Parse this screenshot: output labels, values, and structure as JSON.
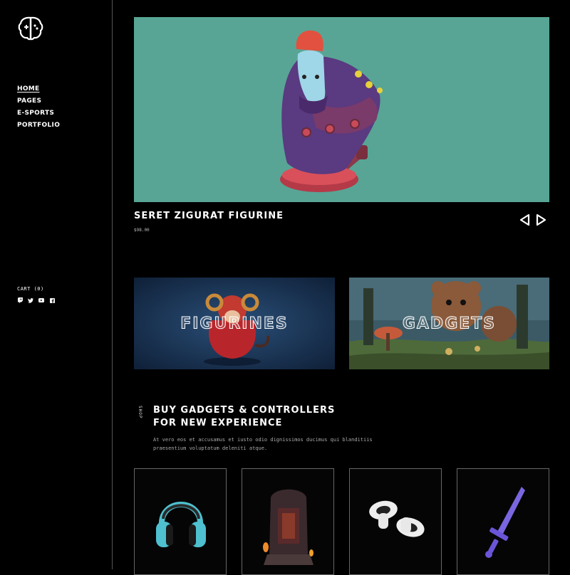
{
  "nav": {
    "items": [
      {
        "label": "HOME",
        "active": true
      },
      {
        "label": "PAGES",
        "active": false
      },
      {
        "label": "E-SPORTS",
        "active": false
      },
      {
        "label": "PORTFOLIO",
        "active": false
      }
    ]
  },
  "cart": {
    "label": "CART (0)"
  },
  "social": [
    "twitch-icon",
    "twitter-icon",
    "youtube-icon",
    "facebook-icon"
  ],
  "hero": {
    "title": "SERET ZIGURAT FIGURINE",
    "price": "$98.00",
    "bg": "#58a595"
  },
  "categories": [
    {
      "label": "FIGURINES"
    },
    {
      "label": "GADGETS"
    }
  ],
  "shop": {
    "side_label": "SHOP",
    "title_line1": "BUY GADGETS & CONTROLLERS",
    "title_line2": "FOR NEW EXPERIENCE",
    "desc_line1": "At vero eos et accusamus et iusto odio dignissimos ducimus qui blanditiis",
    "desc_line2": "praesentium voluptatum deleniti atque."
  },
  "products": [
    "headphones-image",
    "throne-figurine-image",
    "vr-controllers-image",
    "sword-image"
  ]
}
